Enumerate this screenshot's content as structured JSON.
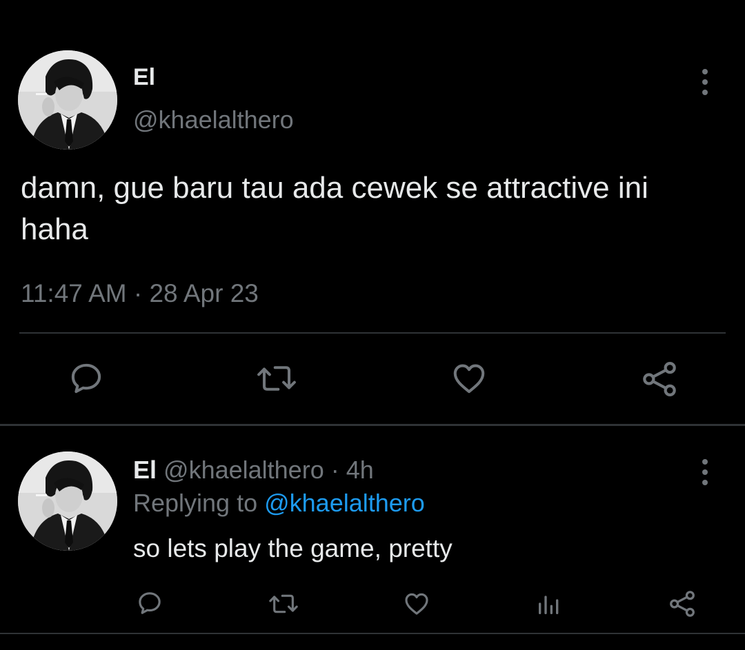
{
  "main_tweet": {
    "display_name": "El",
    "handle": "@khaelalthero",
    "text": "damn, gue baru tau ada cewek se attractive ini haha",
    "timestamp": "11:47 AM · 28 Apr 23",
    "actions": [
      "reply-icon",
      "retweet-icon",
      "like-icon",
      "share-icon"
    ],
    "more_icon": "more-vertical-icon"
  },
  "reply_tweet": {
    "display_name": "El",
    "handle": "@khaelalthero",
    "separator": " · ",
    "age": "4h",
    "replying_prefix": "Replying to ",
    "replying_to": "@khaelalthero",
    "text": "so lets play the game, pretty",
    "actions": [
      "reply-icon",
      "retweet-icon",
      "like-icon",
      "analytics-icon",
      "share-icon"
    ],
    "more_icon": "more-vertical-icon"
  },
  "colors": {
    "background": "#000000",
    "primary_text": "#e7e9ea",
    "secondary_text": "#71767b",
    "link": "#1d9bf0",
    "divider": "#2f3336"
  }
}
